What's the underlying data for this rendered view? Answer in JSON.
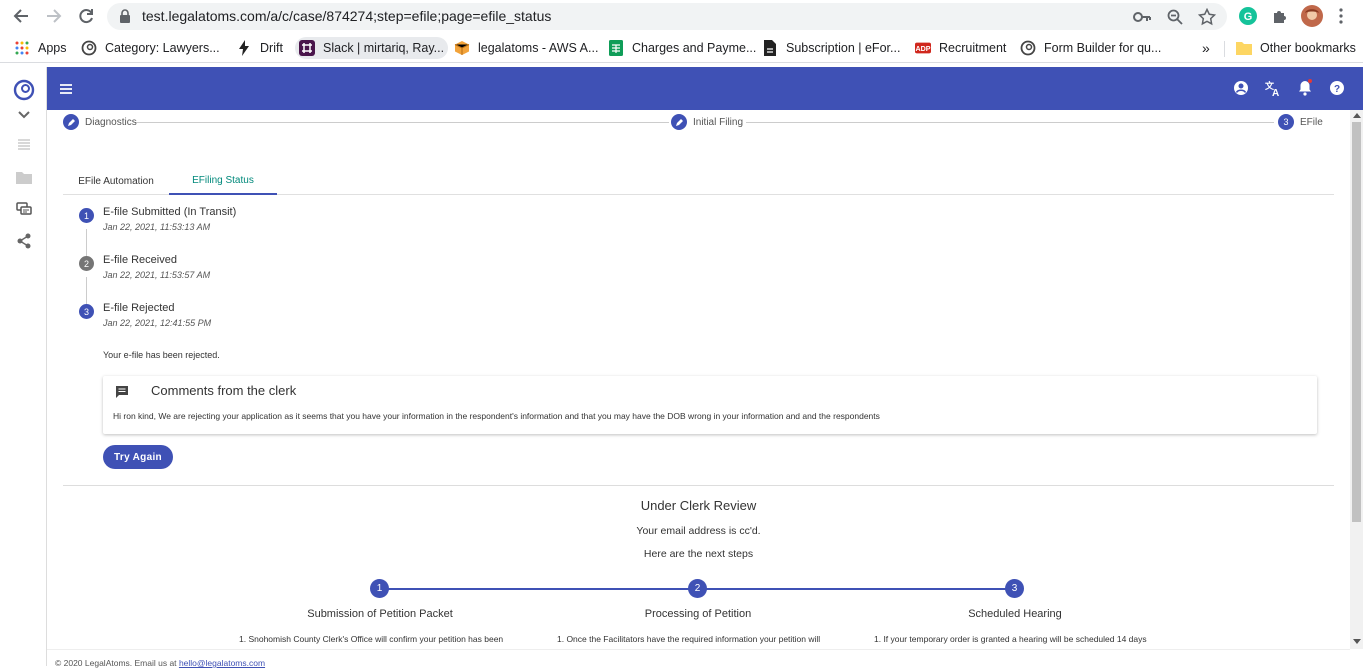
{
  "browser": {
    "url": "test.legalatoms.com/a/c/case/874274;step=efile;page=efile_status",
    "bookmarks": [
      {
        "label": "Apps"
      },
      {
        "label": "Category: Lawyers..."
      },
      {
        "label": "Drift"
      },
      {
        "label": "Slack | mirtariq, Ray..."
      },
      {
        "label": "legalatoms - AWS A..."
      },
      {
        "label": "Charges and Payme..."
      },
      {
        "label": "Subscription | eFor..."
      },
      {
        "label": "Recruitment"
      },
      {
        "label": "Form Builder for qu..."
      }
    ],
    "more": "»",
    "other_bookmarks": "Other bookmarks"
  },
  "stepper": [
    {
      "label": "Diagnostics",
      "marker": ""
    },
    {
      "label": "Initial Filing",
      "marker": ""
    },
    {
      "label": "EFile",
      "marker": "3"
    }
  ],
  "tabs": [
    {
      "label": "EFile Automation"
    },
    {
      "label": "EFiling Status"
    }
  ],
  "timeline": [
    {
      "num": "1",
      "title": "E-file Submitted (In Transit)",
      "time": "Jan 22, 2021, 11:53:13 AM",
      "color": "#3f51b5"
    },
    {
      "num": "2",
      "title": "E-file Received",
      "time": "Jan 22, 2021, 11:53:57 AM",
      "color": "#757575"
    },
    {
      "num": "3",
      "title": "E-file Rejected",
      "time": "Jan 22, 2021, 12:41:55 PM",
      "color": "#3f51b5"
    }
  ],
  "status_message": "Your e-file has been rejected.",
  "comments": {
    "title": "Comments from the clerk",
    "body": "Hi ron kind, We are rejecting your application as it seems that you have your information in the respondent's information and that you may have the DOB wrong in your information and and the respondents"
  },
  "try_again": "Try Again",
  "review": {
    "heading": "Under Clerk Review",
    "email_note": "Your email address is cc'd.",
    "next_steps": "Here are the next steps"
  },
  "process_steps": [
    {
      "num": "1",
      "label": "Submission of Petition Packet",
      "desc": "1.   Snohomish County Clerk's Office will confirm your petition has been"
    },
    {
      "num": "2",
      "label": "Processing of Petition",
      "desc": "1.   Once the Facilitators have the required information your petition will"
    },
    {
      "num": "3",
      "label": "Scheduled Hearing",
      "desc": "1.   If your temporary order is granted a hearing will be scheduled 14 days"
    }
  ],
  "footer": {
    "text": "© 2020 LegalAtoms. Email us at",
    "email": "hello@legalatoms.com"
  },
  "colors": {
    "primary": "#3f51b5",
    "tab_active_text": "#00897b"
  }
}
